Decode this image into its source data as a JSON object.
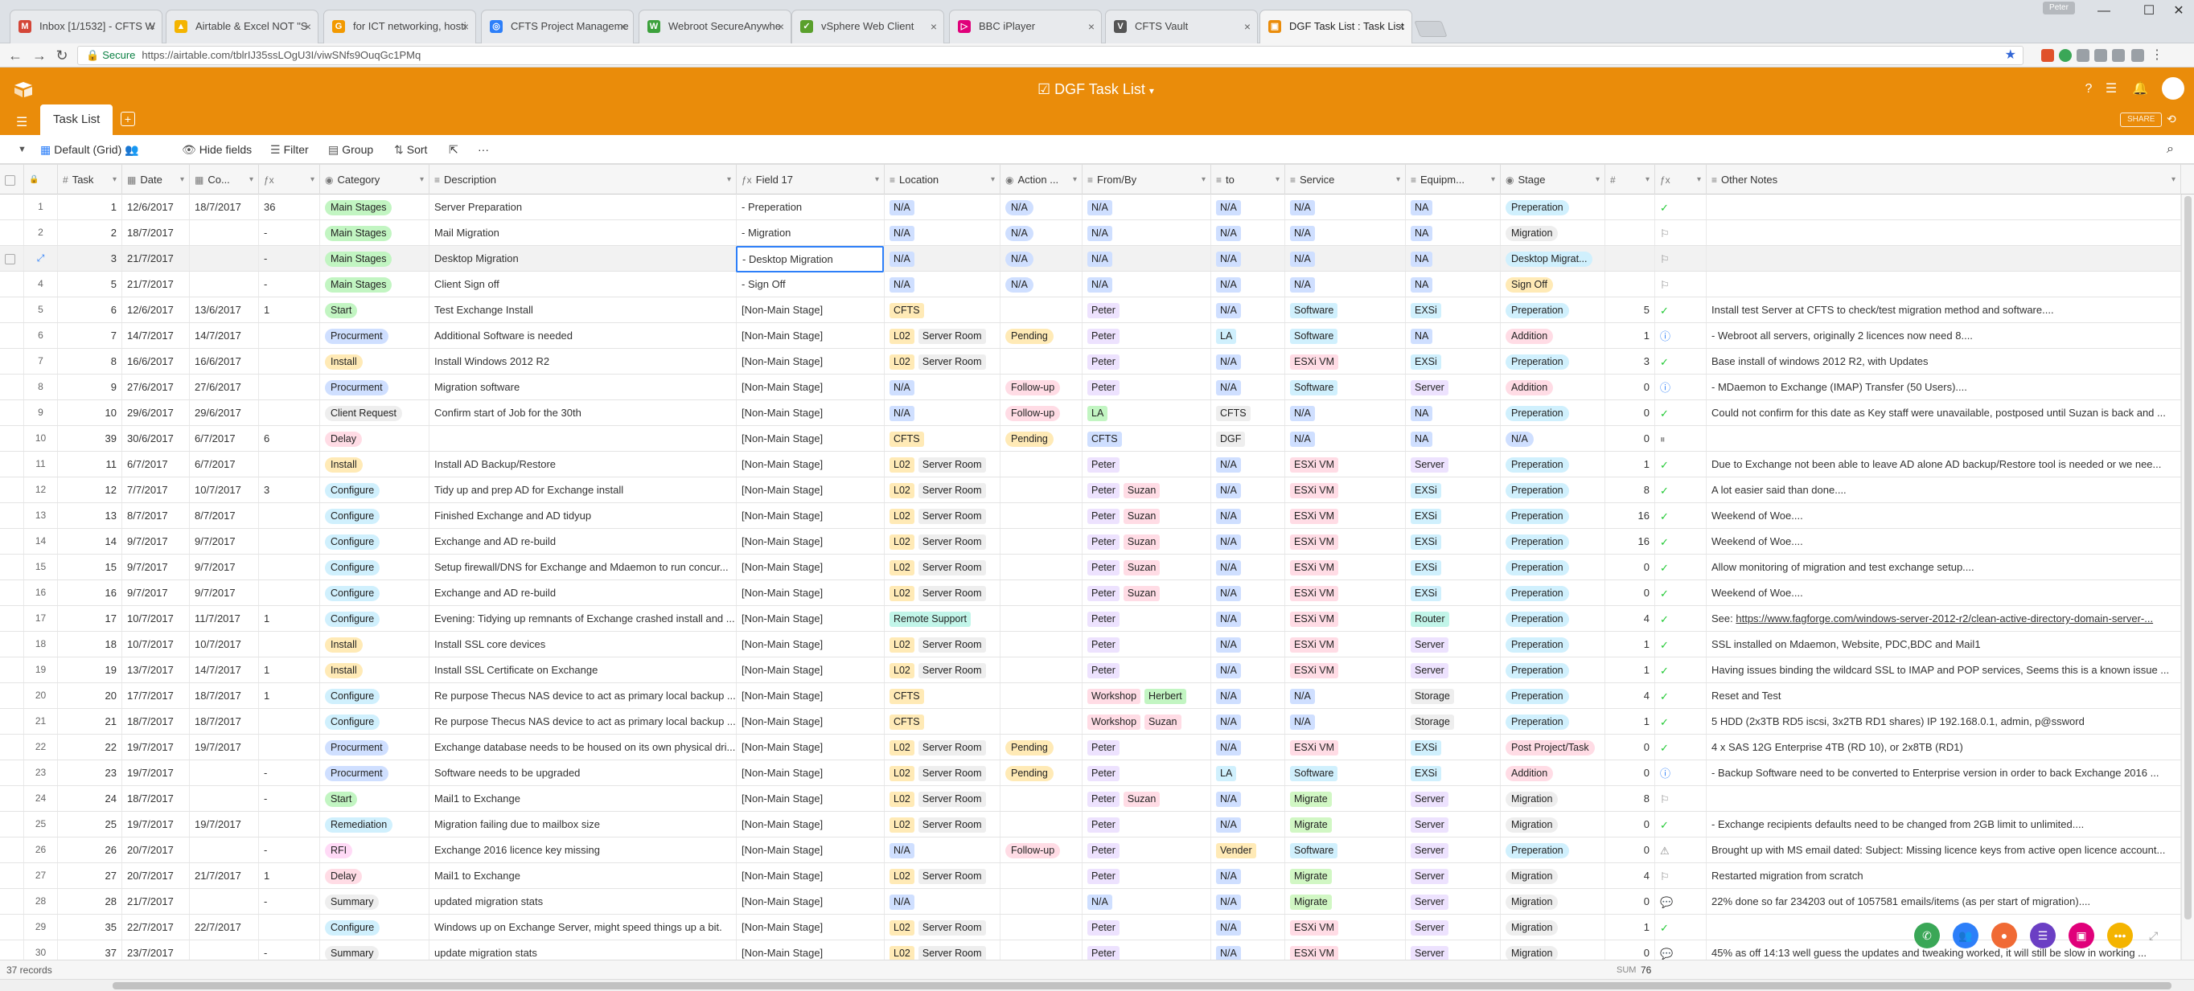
{
  "browser": {
    "tabs": [
      {
        "label": "Inbox [1/1532] - CFTS W",
        "color": "#d44638",
        "glyph": "M"
      },
      {
        "label": "Airtable & Excel NOT \"S",
        "color": "#f4b400",
        "glyph": "▲"
      },
      {
        "label": "for ICT networking, hosti",
        "color": "#f29900",
        "glyph": "G"
      },
      {
        "label": "CFTS Project Manageme",
        "color": "#2d7ff9",
        "glyph": "◎"
      },
      {
        "label": "Webroot SecureAnywhe",
        "color": "#3ca13c",
        "glyph": "W"
      },
      {
        "label": "vSphere Web Client",
        "color": "#5aa02c",
        "glyph": "✓"
      },
      {
        "label": "BBC iPlayer",
        "color": "#e0007a",
        "glyph": "▷"
      },
      {
        "label": "CFTS Vault",
        "color": "#555555",
        "glyph": "V"
      },
      {
        "label": "DGF Task List : Task List",
        "color": "#ea8c0a",
        "glyph": "▣"
      }
    ],
    "user": "Peter",
    "url_secure": "Secure",
    "url": "https://airtable.com/tblrIJ35ssLOgU3I/viwSNfs9OuqGc1PMq"
  },
  "app": {
    "base_title": "DGF Task List",
    "share": "SHARE",
    "table_tab": "Task List",
    "view_name": "Default (Grid)",
    "toolbar": {
      "hide_fields": "Hide fields",
      "filter": "Filter",
      "group": "Group",
      "sort": "Sort",
      "more": "···"
    }
  },
  "columns": [
    "Task",
    "Date",
    "Co...",
    "",
    "Category",
    "Description",
    "Field 17",
    "Location",
    "Action ...",
    "From/By",
    "to",
    "Service",
    "Equipm...",
    "Stage",
    "",
    "",
    "Other Notes"
  ],
  "rows": [
    {
      "rn": "1",
      "task": "1",
      "date": "12/6/2017",
      "co": "18/7/2017",
      "f": "36",
      "cat": "Main Stages",
      "desc": "Server Preparation",
      "f17": "- Preperation",
      "loc": [
        "N/A"
      ],
      "act": "N/A",
      "from": [
        "N/A"
      ],
      "to": "N/A",
      "svc": "N/A",
      "eq": "NA",
      "stage": "Preperation",
      "n": "",
      "st": "check",
      "notes": ""
    },
    {
      "rn": "2",
      "task": "2",
      "date": "18/7/2017",
      "co": "",
      "f": "-",
      "cat": "Main Stages",
      "desc": "Mail Migration",
      "f17": "- Migration",
      "loc": [
        "N/A"
      ],
      "act": "N/A",
      "from": [
        "N/A"
      ],
      "to": "N/A",
      "svc": "N/A",
      "eq": "NA",
      "stage": "Migration",
      "n": "",
      "st": "run",
      "notes": ""
    },
    {
      "rn": "",
      "task": "3",
      "date": "21/7/2017",
      "co": "",
      "f": "-",
      "cat": "Main Stages",
      "desc": "Desktop Migration",
      "f17": "- Desktop Migration",
      "loc": [
        "N/A"
      ],
      "act": "N/A",
      "from": [
        "N/A"
      ],
      "to": "N/A",
      "svc": "N/A",
      "eq": "NA",
      "stage": "Desktop Migrat...",
      "n": "",
      "st": "run",
      "notes": ""
    },
    {
      "rn": "4",
      "task": "5",
      "date": "21/7/2017",
      "co": "",
      "f": "-",
      "cat": "Main Stages",
      "desc": "Client Sign off",
      "f17": "- Sign Off",
      "loc": [
        "N/A"
      ],
      "act": "N/A",
      "from": [
        "N/A"
      ],
      "to": "N/A",
      "svc": "N/A",
      "eq": "NA",
      "stage": "Sign Off",
      "n": "",
      "st": "run",
      "notes": ""
    },
    {
      "rn": "5",
      "task": "6",
      "date": "12/6/2017",
      "co": "13/6/2017",
      "f": "1",
      "cat": "Start",
      "desc": "Test Exchange Install",
      "f17": "[Non-Main Stage]",
      "loc": [
        "CFTS"
      ],
      "act": "",
      "from": [
        "Peter"
      ],
      "to": "N/A",
      "svc": "Software",
      "eq": "EXSi",
      "stage": "Preperation",
      "n": "5",
      "st": "check",
      "notes": "Install test Server at CFTS to check/test migration method and software...."
    },
    {
      "rn": "6",
      "task": "7",
      "date": "14/7/2017",
      "co": "14/7/2017",
      "f": "",
      "cat": "Procurment",
      "desc": "Additional Software is needed",
      "f17": "[Non-Main Stage]",
      "loc": [
        "L02",
        "Server Room"
      ],
      "act": "Pending",
      "from": [
        "Peter"
      ],
      "to": "LA",
      "svc": "Software",
      "eq": "NA",
      "stage": "Addition",
      "n": "1",
      "st": "info",
      "notes": "- Webroot all servers, originally 2 licences now need 8...."
    },
    {
      "rn": "7",
      "task": "8",
      "date": "16/6/2017",
      "co": "16/6/2017",
      "f": "",
      "cat": "Install",
      "desc": "Install Windows 2012 R2",
      "f17": "[Non-Main Stage]",
      "loc": [
        "L02",
        "Server Room"
      ],
      "act": "",
      "from": [
        "Peter"
      ],
      "to": "N/A",
      "svc": "ESXi VM",
      "eq": "EXSi",
      "stage": "Preperation",
      "n": "3",
      "st": "check",
      "notes": "Base install of windows 2012 R2, with Updates"
    },
    {
      "rn": "8",
      "task": "9",
      "date": "27/6/2017",
      "co": "27/6/2017",
      "f": "",
      "cat": "Procurment",
      "desc": "Migration software",
      "f17": "[Non-Main Stage]",
      "loc": [
        "N/A"
      ],
      "act": "Follow-up",
      "from": [
        "Peter"
      ],
      "to": "N/A",
      "svc": "Software",
      "eq": "Server",
      "stage": "Addition",
      "n": "0",
      "st": "info",
      "notes": "- MDaemon to Exchange (IMAP) Transfer (50 Users)...."
    },
    {
      "rn": "9",
      "task": "10",
      "date": "29/6/2017",
      "co": "29/6/2017",
      "f": "",
      "cat": "Client Request",
      "desc": "Confirm start of Job for the 30th",
      "f17": "[Non-Main Stage]",
      "loc": [
        "N/A"
      ],
      "act": "Follow-up",
      "from": [
        "LA"
      ],
      "to": "CFTS",
      "svc": "N/A",
      "eq": "NA",
      "stage": "Preperation",
      "n": "0",
      "st": "check",
      "notes": "Could not confirm for this date as Key staff were unavailable, postposed until Suzan is back and ..."
    },
    {
      "rn": "10",
      "task": "39",
      "date": "30/6/2017",
      "co": "6/7/2017",
      "f": "6",
      "cat": "Delay",
      "desc": "",
      "f17": "[Non-Main Stage]",
      "loc": [
        "CFTS"
      ],
      "act": "Pending",
      "from": [
        "CFTS"
      ],
      "to": "DGF",
      "svc": "N/A",
      "eq": "NA",
      "stage": "N/A",
      "n": "0",
      "st": "pause",
      "notes": ""
    },
    {
      "rn": "11",
      "task": "11",
      "date": "6/7/2017",
      "co": "6/7/2017",
      "f": "",
      "cat": "Install",
      "desc": "Install AD Backup/Restore",
      "f17": "[Non-Main Stage]",
      "loc": [
        "L02",
        "Server Room"
      ],
      "act": "",
      "from": [
        "Peter"
      ],
      "to": "N/A",
      "svc": "ESXi VM",
      "eq": "Server",
      "stage": "Preperation",
      "n": "1",
      "st": "check",
      "notes": "Due to Exchange not been able to leave AD alone AD backup/Restore tool is needed or we nee..."
    },
    {
      "rn": "12",
      "task": "12",
      "date": "7/7/2017",
      "co": "10/7/2017",
      "f": "3",
      "cat": "Configure",
      "desc": "Tidy up and prep AD for Exchange install",
      "f17": "[Non-Main Stage]",
      "loc": [
        "L02",
        "Server Room"
      ],
      "act": "",
      "from": [
        "Peter",
        "Suzan"
      ],
      "to": "N/A",
      "svc": "ESXi VM",
      "eq": "EXSi",
      "stage": "Preperation",
      "n": "8",
      "st": "check",
      "notes": "A lot easier said than done...."
    },
    {
      "rn": "13",
      "task": "13",
      "date": "8/7/2017",
      "co": "8/7/2017",
      "f": "",
      "cat": "Configure",
      "desc": "Finished Exchange and AD tidyup",
      "f17": "[Non-Main Stage]",
      "loc": [
        "L02",
        "Server Room"
      ],
      "act": "",
      "from": [
        "Peter",
        "Suzan"
      ],
      "to": "N/A",
      "svc": "ESXi VM",
      "eq": "EXSi",
      "stage": "Preperation",
      "n": "16",
      "st": "check",
      "notes": "Weekend of Woe...."
    },
    {
      "rn": "14",
      "task": "14",
      "date": "9/7/2017",
      "co": "9/7/2017",
      "f": "",
      "cat": "Configure",
      "desc": "Exchange and AD re-build",
      "f17": "[Non-Main Stage]",
      "loc": [
        "L02",
        "Server Room"
      ],
      "act": "",
      "from": [
        "Peter",
        "Suzan"
      ],
      "to": "N/A",
      "svc": "ESXi VM",
      "eq": "EXSi",
      "stage": "Preperation",
      "n": "16",
      "st": "check",
      "notes": "Weekend of Woe...."
    },
    {
      "rn": "15",
      "task": "15",
      "date": "9/7/2017",
      "co": "9/7/2017",
      "f": "",
      "cat": "Configure",
      "desc": "Setup firewall/DNS for Exchange and Mdaemon to run concur...",
      "f17": "[Non-Main Stage]",
      "loc": [
        "L02",
        "Server Room"
      ],
      "act": "",
      "from": [
        "Peter",
        "Suzan"
      ],
      "to": "N/A",
      "svc": "ESXi VM",
      "eq": "EXSi",
      "stage": "Preperation",
      "n": "0",
      "st": "check",
      "notes": "Allow monitoring of  migration and test exchange setup...."
    },
    {
      "rn": "16",
      "task": "16",
      "date": "9/7/2017",
      "co": "9/7/2017",
      "f": "",
      "cat": "Configure",
      "desc": "Exchange and AD re-build",
      "f17": "[Non-Main Stage]",
      "loc": [
        "L02",
        "Server Room"
      ],
      "act": "",
      "from": [
        "Peter",
        "Suzan"
      ],
      "to": "N/A",
      "svc": "ESXi VM",
      "eq": "EXSi",
      "stage": "Preperation",
      "n": "0",
      "st": "check",
      "notes": "Weekend of Woe...."
    },
    {
      "rn": "17",
      "task": "17",
      "date": "10/7/2017",
      "co": "11/7/2017",
      "f": "1",
      "cat": "Configure",
      "desc": "Evening: Tidying up remnants of Exchange crashed install and ...",
      "f17": "[Non-Main Stage]",
      "loc": [
        "Remote Support"
      ],
      "act": "",
      "from": [
        "Peter"
      ],
      "to": "N/A",
      "svc": "ESXi VM",
      "eq": "Router",
      "stage": "Preperation",
      "n": "4",
      "st": "check",
      "notes": "See: https://www.fagforge.com/windows-server-2012-r2/clean-active-directory-domain-server-..."
    },
    {
      "rn": "18",
      "task": "18",
      "date": "10/7/2017",
      "co": "10/7/2017",
      "f": "",
      "cat": "Install",
      "desc": "Install SSL core devices",
      "f17": "[Non-Main Stage]",
      "loc": [
        "L02",
        "Server Room"
      ],
      "act": "",
      "from": [
        "Peter"
      ],
      "to": "N/A",
      "svc": "ESXi VM",
      "eq": "Server",
      "stage": "Preperation",
      "n": "1",
      "st": "check",
      "notes": "SSL installed on Mdaemon, Website, PDC,BDC and Mail1"
    },
    {
      "rn": "19",
      "task": "19",
      "date": "13/7/2017",
      "co": "14/7/2017",
      "f": "1",
      "cat": "Install",
      "desc": "Install SSL Certificate on Exchange",
      "f17": "[Non-Main Stage]",
      "loc": [
        "L02",
        "Server Room"
      ],
      "act": "",
      "from": [
        "Peter"
      ],
      "to": "N/A",
      "svc": "ESXi VM",
      "eq": "Server",
      "stage": "Preperation",
      "n": "1",
      "st": "check",
      "notes": "Having issues binding the wildcard SSL to IMAP and POP services, Seems this is a known issue ..."
    },
    {
      "rn": "20",
      "task": "20",
      "date": "17/7/2017",
      "co": "18/7/2017",
      "f": "1",
      "cat": "Configure",
      "desc": "Re purpose Thecus NAS device to act as primary local backup ...",
      "f17": "[Non-Main Stage]",
      "loc": [
        "CFTS"
      ],
      "act": "",
      "from": [
        "Workshop",
        "Herbert"
      ],
      "to": "N/A",
      "svc": "N/A",
      "eq": "Storage",
      "stage": "Preperation",
      "n": "4",
      "st": "check",
      "notes": "Reset and Test"
    },
    {
      "rn": "21",
      "task": "21",
      "date": "18/7/2017",
      "co": "18/7/2017",
      "f": "",
      "cat": "Configure",
      "desc": "Re purpose Thecus NAS device to act as primary local backup ...",
      "f17": "[Non-Main Stage]",
      "loc": [
        "CFTS"
      ],
      "act": "",
      "from": [
        "Workshop",
        "Suzan"
      ],
      "to": "N/A",
      "svc": "N/A",
      "eq": "Storage",
      "stage": "Preperation",
      "n": "1",
      "st": "check",
      "notes": "5 HDD (2x3TB RD5 iscsi, 3x2TB RD1 shares) IP 192.168.0.1, admin, p@ssword"
    },
    {
      "rn": "22",
      "task": "22",
      "date": "19/7/2017",
      "co": "19/7/2017",
      "f": "",
      "cat": "Procurment",
      "desc": "Exchange database needs to be housed on its own physical dri...",
      "f17": "[Non-Main Stage]",
      "loc": [
        "L02",
        "Server Room"
      ],
      "act": "Pending",
      "from": [
        "Peter"
      ],
      "to": "N/A",
      "svc": "ESXi VM",
      "eq": "EXSi",
      "stage": "Post Project/Task",
      "n": "0",
      "st": "check",
      "notes": "4 x SAS 12G Enterprise 4TB (RD 10), or 2x8TB (RD1)"
    },
    {
      "rn": "23",
      "task": "23",
      "date": "19/7/2017",
      "co": "",
      "f": "-",
      "cat": "Procurment",
      "desc": "Software needs to be upgraded",
      "f17": "[Non-Main Stage]",
      "loc": [
        "L02",
        "Server Room"
      ],
      "act": "Pending",
      "from": [
        "Peter"
      ],
      "to": "LA",
      "svc": "Software",
      "eq": "EXSi",
      "stage": "Addition",
      "n": "0",
      "st": "info",
      "notes": "- Backup Software need to be converted to Enterprise version in order to back Exchange 2016 ..."
    },
    {
      "rn": "24",
      "task": "24",
      "date": "18/7/2017",
      "co": "",
      "f": "-",
      "cat": "Start",
      "desc": "Mail1 to Exchange",
      "f17": "[Non-Main Stage]",
      "loc": [
        "L02",
        "Server Room"
      ],
      "act": "",
      "from": [
        "Peter",
        "Suzan"
      ],
      "to": "N/A",
      "svc": "Migrate",
      "eq": "Server",
      "stage": "Migration",
      "n": "8",
      "st": "run",
      "notes": ""
    },
    {
      "rn": "25",
      "task": "25",
      "date": "19/7/2017",
      "co": "19/7/2017",
      "f": "",
      "cat": "Remediation",
      "desc": "Migration failing due to mailbox size",
      "f17": "[Non-Main Stage]",
      "loc": [
        "L02",
        "Server Room"
      ],
      "act": "",
      "from": [
        "Peter"
      ],
      "to": "N/A",
      "svc": "Migrate",
      "eq": "Server",
      "stage": "Migration",
      "n": "0",
      "st": "check",
      "notes": "- Exchange recipients defaults need to be changed from 2GB limit to unlimited...."
    },
    {
      "rn": "26",
      "task": "26",
      "date": "20/7/2017",
      "co": "",
      "f": "-",
      "cat": "RFI",
      "desc": "Exchange 2016 licence key missing",
      "f17": "[Non-Main Stage]",
      "loc": [
        "N/A"
      ],
      "act": "Follow-up",
      "from": [
        "Peter"
      ],
      "to": "Vender",
      "svc": "Software",
      "eq": "Server",
      "stage": "Preperation",
      "n": "0",
      "st": "warn",
      "notes": "Brought up with MS email dated: Subject: Missing licence keys from active open licence account..."
    },
    {
      "rn": "27",
      "task": "27",
      "date": "20/7/2017",
      "co": "21/7/2017",
      "f": "1",
      "cat": "Delay",
      "desc": "Mail1 to Exchange",
      "f17": "[Non-Main Stage]",
      "loc": [
        "L02",
        "Server Room"
      ],
      "act": "",
      "from": [
        "Peter"
      ],
      "to": "N/A",
      "svc": "Migrate",
      "eq": "Server",
      "stage": "Migration",
      "n": "4",
      "st": "run",
      "notes": "Restarted migration from scratch"
    },
    {
      "rn": "28",
      "task": "28",
      "date": "21/7/2017",
      "co": "",
      "f": "-",
      "cat": "Summary",
      "desc": "updated migration stats",
      "f17": "[Non-Main Stage]",
      "loc": [
        "N/A"
      ],
      "act": "",
      "from": [
        "N/A"
      ],
      "to": "N/A",
      "svc": "Migrate",
      "eq": "Server",
      "stage": "Migration",
      "n": "0",
      "st": "note",
      "notes": "22% done so far 234203 out of 1057581 emails/items (as per start of migration)...."
    },
    {
      "rn": "29",
      "task": "35",
      "date": "22/7/2017",
      "co": "22/7/2017",
      "f": "",
      "cat": "Configure",
      "desc": "Windows up on Exchange Server, might speed things up a bit.",
      "f17": "[Non-Main Stage]",
      "loc": [
        "L02",
        "Server Room"
      ],
      "act": "",
      "from": [
        "Peter"
      ],
      "to": "N/A",
      "svc": "ESXi VM",
      "eq": "Server",
      "stage": "Migration",
      "n": "1",
      "st": "check",
      "notes": ""
    },
    {
      "rn": "30",
      "task": "37",
      "date": "23/7/2017",
      "co": "",
      "f": "-",
      "cat": "Summary",
      "desc": "update migration stats",
      "f17": "[Non-Main Stage]",
      "loc": [
        "L02",
        "Server Room"
      ],
      "act": "",
      "from": [
        "Peter"
      ],
      "to": "N/A",
      "svc": "ESXi VM",
      "eq": "Server",
      "stage": "Migration",
      "n": "0",
      "st": "note",
      "notes": "45% as off 14:13 well guess the updates and tweaking worked, it will still be slow in working ..."
    }
  ],
  "footer": {
    "records": "37 records",
    "sum_label": "SUM",
    "sum_value": "76"
  },
  "colors": {
    "header": "#ea8c0a",
    "selection": "#2d7ff9"
  }
}
